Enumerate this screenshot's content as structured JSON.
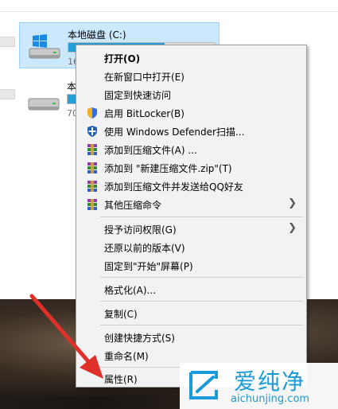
{
  "drives": [
    {
      "name": "本地磁盘 (C:)",
      "free_text": "16",
      "used_fraction": 0.66,
      "selected": true,
      "icon": "windows-drive-icon"
    },
    {
      "name": "本",
      "free_text": "70",
      "used_fraction": 0.08,
      "selected": false,
      "icon": "hard-drive-icon"
    }
  ],
  "context_menu": {
    "items": [
      {
        "label": "打开(O)"
      },
      {
        "label": "在新窗口中打开(E)"
      },
      {
        "label": "固定到快速访问"
      },
      {
        "label": "启用 BitLocker(B)"
      },
      {
        "label": "使用 Windows Defender扫描..."
      },
      {
        "label": "添加到压缩文件(A) ..."
      },
      {
        "label": "添加到 \"新建压缩文件.zip\"(T)"
      },
      {
        "label": "添加到压缩文件并发送给QQ好友"
      },
      {
        "label": "其他压缩命令"
      },
      {
        "label": "授予访问权限(G)"
      },
      {
        "label": "还原以前的版本(V)"
      },
      {
        "label": "固定到\"开始\"屏幕(P)"
      },
      {
        "label": "格式化(A)..."
      },
      {
        "label": "复制(C)"
      },
      {
        "label": "创建快捷方式(S)"
      },
      {
        "label": "重命名(M)"
      },
      {
        "label": "属性(R)"
      }
    ],
    "submenu_glyph": "❯"
  },
  "watermark": {
    "brand": "爱纯净",
    "url": "aichunjing.com"
  },
  "colors": {
    "selection": "#cce8ff",
    "drive_bar": "#26a0da",
    "arrow": "#e0302a",
    "watermark": "#1a9ad6"
  }
}
